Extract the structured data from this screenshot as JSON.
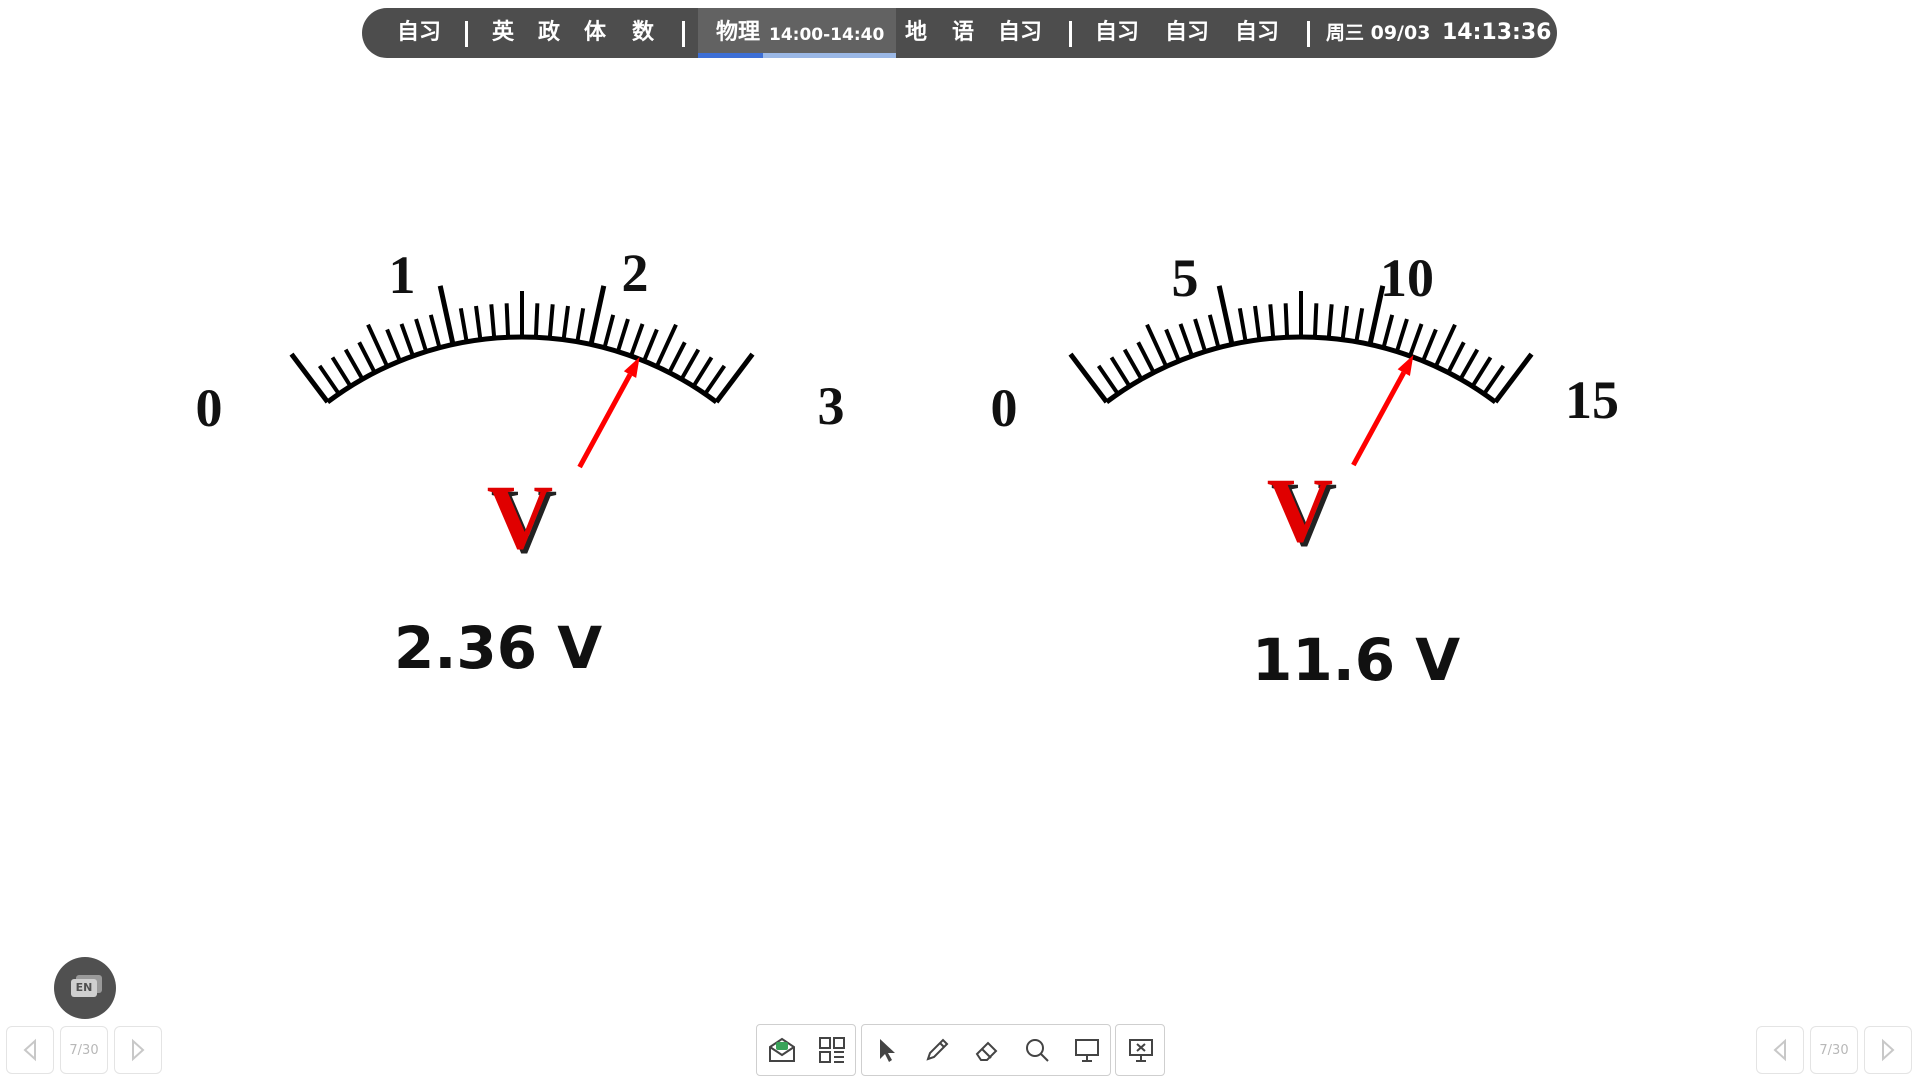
{
  "schedule": {
    "items": [
      {
        "label": "自习"
      },
      {
        "label": "英"
      },
      {
        "label": "政"
      },
      {
        "label": "体"
      },
      {
        "label": "数"
      },
      {
        "label": "物理"
      },
      {
        "label": "地"
      },
      {
        "label": "语"
      },
      {
        "label": "自习"
      },
      {
        "label": "自习"
      },
      {
        "label": "自习"
      },
      {
        "label": "自习"
      }
    ],
    "current_time_range": "14:00-14:40",
    "current_progress": 0.33,
    "date": "周三 09/03",
    "clock": "14:13:36"
  },
  "meters": [
    {
      "scale_labels": [
        "0",
        "1",
        "2",
        "3"
      ],
      "max": 3,
      "unit_symbol": "V",
      "reading_text": "2.36 V",
      "reading_value": 2.36
    },
    {
      "scale_labels": [
        "0",
        "5",
        "10",
        "15"
      ],
      "max": 15,
      "unit_symbol": "V",
      "reading_text": "11.6 V",
      "reading_value": 11.6
    }
  ],
  "language_button": {
    "label": "EN"
  },
  "pagination": {
    "current": 7,
    "total": 30,
    "label": "7/30"
  },
  "toolbar": {
    "tools": [
      "envelope-icon",
      "qr-grid-icon",
      "pointer-icon",
      "pen-icon",
      "eraser-icon",
      "search-icon",
      "screen-icon",
      "close-screen-icon"
    ]
  },
  "colors": {
    "pointer": "#ff0000",
    "unit": "#e00000",
    "bar": "#4d4d4d",
    "progress": "#3d6fd6"
  }
}
